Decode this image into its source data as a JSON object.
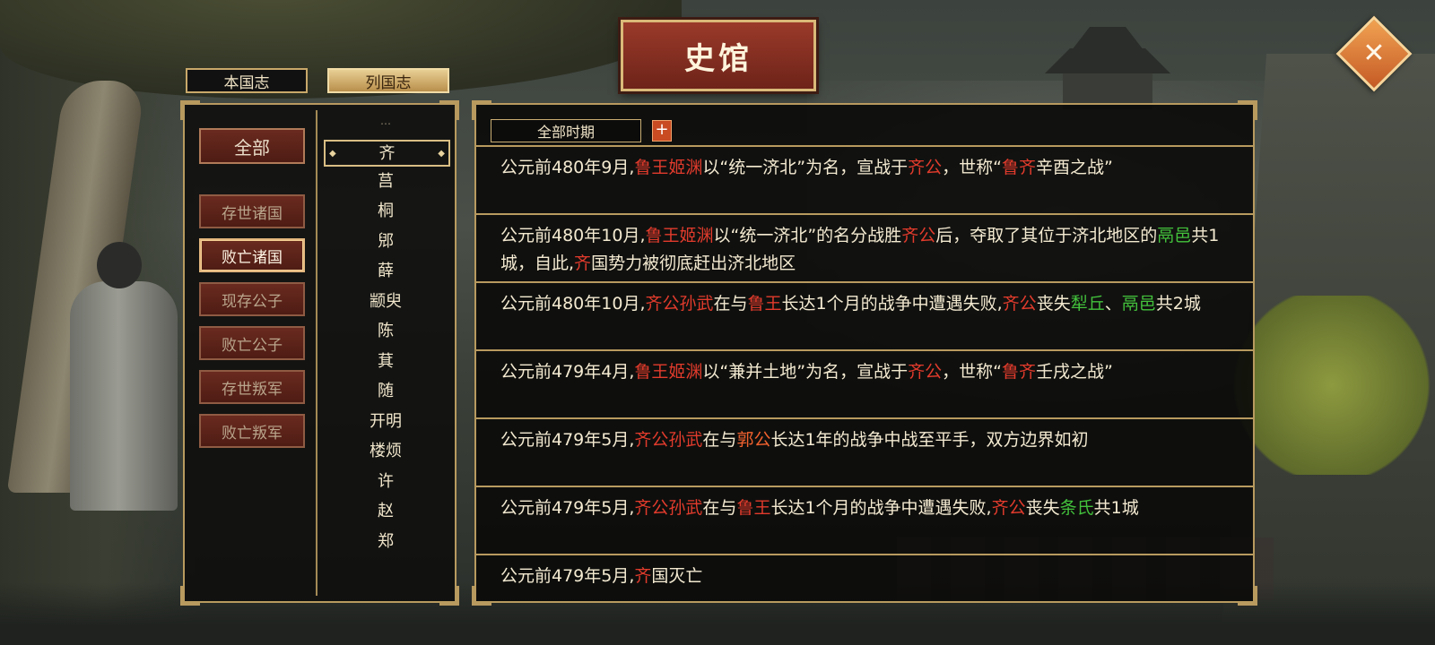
{
  "title": "史馆",
  "tabs": [
    {
      "label": "本国志",
      "active": false
    },
    {
      "label": "列国志",
      "active": true
    }
  ],
  "categories": [
    {
      "label": "全部",
      "active": false
    },
    {
      "label": "存世诸国",
      "active": false
    },
    {
      "label": "败亡诸国",
      "active": true
    },
    {
      "label": "现存公子",
      "active": false
    },
    {
      "label": "败亡公子",
      "active": false
    },
    {
      "label": "存世叛军",
      "active": false
    },
    {
      "label": "败亡叛军",
      "active": false
    }
  ],
  "nations_partial_top": "…",
  "nations": [
    "齐",
    "莒",
    "桐",
    "郳",
    "薛",
    "颛臾",
    "陈",
    "萁",
    "随",
    "开明",
    "楼烦",
    "许",
    "赵",
    "郑"
  ],
  "selected_nation": "齐",
  "period_filter": {
    "label": "全部时期",
    "plus": "+"
  },
  "colors": {
    "person": "#e23b2c",
    "place": "#43c23c",
    "neighbor": "#f0612e"
  },
  "records": [
    [
      [
        "公元前480年9月,",
        ""
      ],
      [
        "鲁王姬渊",
        "p"
      ],
      [
        "以“统一济北”为名，宣战于",
        ""
      ],
      [
        "齐公",
        "p"
      ],
      [
        "，世称“",
        ""
      ],
      [
        "鲁齐",
        "p"
      ],
      [
        "辛酉之战”",
        ""
      ]
    ],
    [
      [
        "公元前480年10月,",
        ""
      ],
      [
        "鲁王姬渊",
        "p"
      ],
      [
        "以“统一济北”的名分战胜",
        ""
      ],
      [
        "齐公",
        "p"
      ],
      [
        "后，夺取了其位于济北地区的",
        ""
      ],
      [
        "鬲邑",
        "g"
      ],
      [
        "共1城，自此,",
        ""
      ],
      [
        "齐",
        "p"
      ],
      [
        "国势力被彻底赶出济北地区",
        ""
      ]
    ],
    [
      [
        "公元前480年10月,",
        ""
      ],
      [
        "齐公孙武",
        "p"
      ],
      [
        "在与",
        ""
      ],
      [
        "鲁王",
        "p"
      ],
      [
        "长达1个月的战争中遭遇失败,",
        ""
      ],
      [
        "齐公",
        "p"
      ],
      [
        "丧失",
        ""
      ],
      [
        "犁丘",
        "g"
      ],
      [
        "、",
        ""
      ],
      [
        "鬲邑",
        "g"
      ],
      [
        "共2城",
        ""
      ]
    ],
    [
      [
        "公元前479年4月,",
        ""
      ],
      [
        "鲁王姬渊",
        "p"
      ],
      [
        "以“兼并土地”为名，宣战于",
        ""
      ],
      [
        "齐公",
        "p"
      ],
      [
        "，世称“",
        ""
      ],
      [
        "鲁齐",
        "p"
      ],
      [
        "壬戌之战”",
        ""
      ]
    ],
    [
      [
        "公元前479年5月,",
        ""
      ],
      [
        "齐公孙武",
        "p"
      ],
      [
        "在与",
        ""
      ],
      [
        "郭公",
        "o"
      ],
      [
        "长达1年的战争中战至平手，双方边界如初",
        ""
      ]
    ],
    [
      [
        "公元前479年5月,",
        ""
      ],
      [
        "齐公孙武",
        "p"
      ],
      [
        "在与",
        ""
      ],
      [
        "鲁王",
        "p"
      ],
      [
        "长达1个月的战争中遭遇失败,",
        ""
      ],
      [
        "齐公",
        "p"
      ],
      [
        "丧失",
        ""
      ],
      [
        "条氏",
        "g"
      ],
      [
        "共1城",
        ""
      ]
    ],
    [
      [
        "公元前479年5月,",
        ""
      ],
      [
        "齐",
        "p"
      ],
      [
        "国灭亡",
        ""
      ]
    ]
  ]
}
